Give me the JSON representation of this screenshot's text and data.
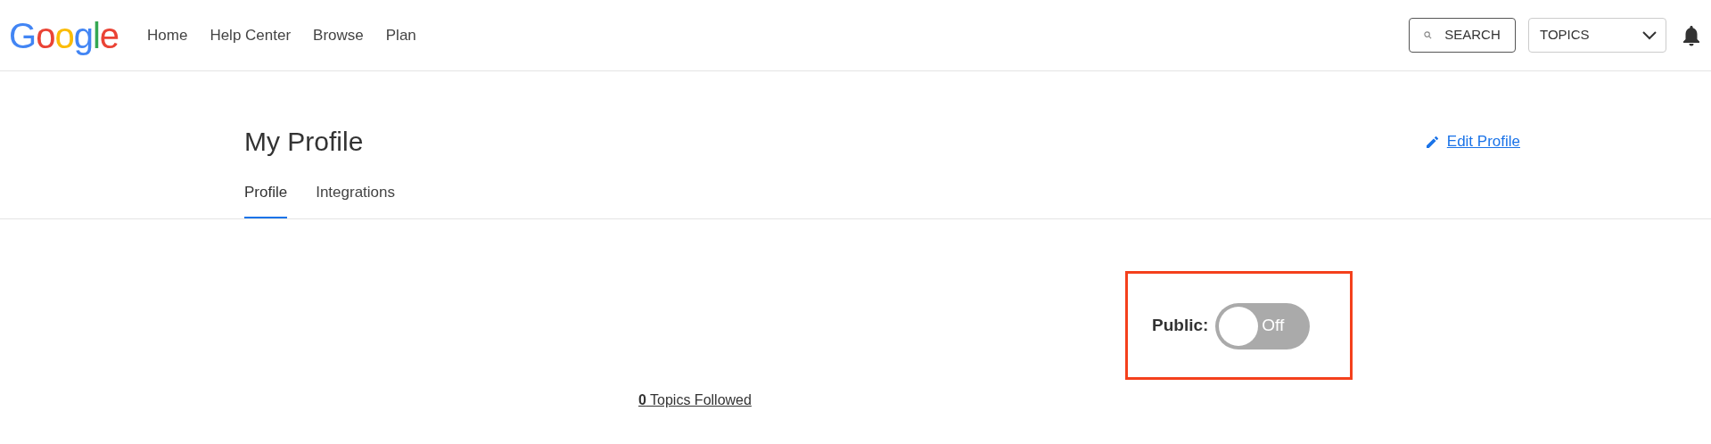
{
  "header": {
    "logo": "Google",
    "nav": [
      {
        "label": "Home"
      },
      {
        "label": "Help Center"
      },
      {
        "label": "Browse"
      },
      {
        "label": "Plan"
      }
    ],
    "search_button": "SEARCH",
    "topics_dropdown": "TOPICS"
  },
  "page": {
    "title": "My Profile",
    "edit_link": "Edit Profile",
    "tabs": [
      {
        "label": "Profile",
        "selected": true
      },
      {
        "label": "Integrations",
        "selected": false
      }
    ]
  },
  "public_toggle": {
    "label": "Public:",
    "on": false,
    "state_text": "Off",
    "highlighted": true
  },
  "topics_followed": "**0** Topics Followed"
}
